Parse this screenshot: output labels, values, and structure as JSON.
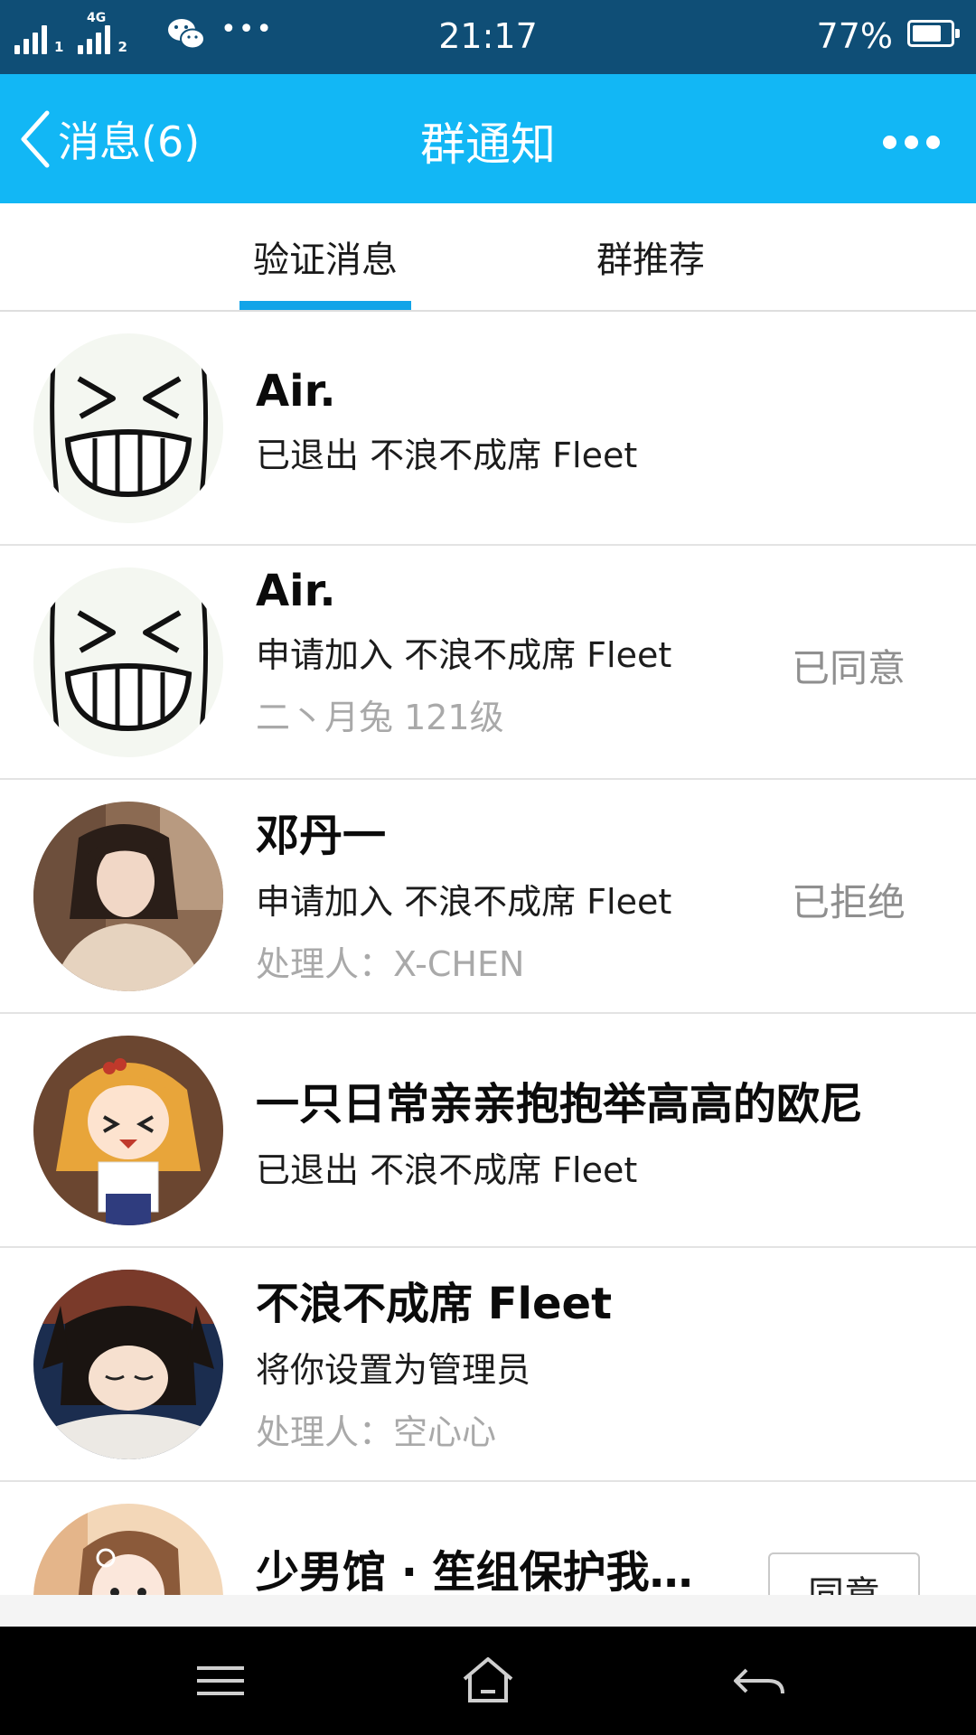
{
  "status_bar": {
    "sim1": "1",
    "sim2": "2",
    "network": "4G",
    "time": "21:17",
    "battery_percent_text": "77%",
    "battery_level": 0.77,
    "icons": [
      "signal-icon",
      "wechat-icon",
      "more-notifications-icon",
      "battery-icon"
    ]
  },
  "title_bar": {
    "back_label": "消息(6)",
    "title": "群通知",
    "accent_color": "#12b7f5"
  },
  "tabs": [
    {
      "label": "验证消息",
      "active": true
    },
    {
      "label": "群推荐",
      "active": false
    }
  ],
  "notifications": [
    {
      "name": "Air.",
      "action": "已退出 不浪不成席 Fleet",
      "meta": "",
      "status": "",
      "avatar": "smiley-face"
    },
    {
      "name": "Air.",
      "action": "申请加入 不浪不成席 Fleet",
      "meta": "二丶月兔  121级",
      "status": "已同意",
      "avatar": "smiley-face"
    },
    {
      "name": "邓丹一",
      "action": "申请加入 不浪不成席 Fleet",
      "meta": "处理人：X-CHEN",
      "status": "已拒绝",
      "avatar": "photo-girl"
    },
    {
      "name": "一只日常亲亲抱抱举高高的欧尼",
      "action": "已退出 不浪不成席 Fleet",
      "meta": "",
      "status": "",
      "avatar": "anime-girl"
    },
    {
      "name": "不浪不成席 Fleet",
      "action": "将你设置为管理员",
      "meta": "处理人：空心心",
      "status": "",
      "avatar": "anime-sleeping"
    },
    {
      "name": "少男馆 · 笙组保护我…",
      "action": "",
      "meta": "",
      "status": "",
      "button": "同意",
      "avatar": "photo-cartoon"
    }
  ],
  "nav_bar": {
    "buttons": [
      "menu-icon",
      "home-icon",
      "back-icon"
    ]
  }
}
